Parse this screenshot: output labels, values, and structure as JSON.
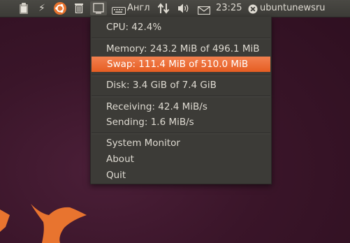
{
  "topbar": {
    "keyboard_layout": "Англ",
    "clock": "23:25",
    "username": "ubuntunewsru",
    "icons": [
      "clipboard-icon",
      "bolt-icon",
      "ubuntu-icon",
      "trash-icon",
      "system-monitor-icon",
      "keyboard-icon",
      "network-arrows-icon",
      "volume-icon",
      "mail-icon",
      "session-icon"
    ]
  },
  "menu": {
    "cpu": "CPU: 42.4%",
    "memory": "Memory: 243.2 MiB of 496.1 MiB",
    "swap": "Swap: 111.4 MiB of 510.0 MiB",
    "disk": "Disk: 3.4 GiB of 7.4 GiB",
    "receiving": "Receiving: 42.4 MiB/s",
    "sending": "Sending: 1.6 MiB/s",
    "system_monitor": "System Monitor",
    "about": "About",
    "quit": "Quit"
  },
  "colors": {
    "panel": "#3c3b37",
    "highlight": "#e9662c",
    "text": "#dfdbd2",
    "desktop": "#3a1529",
    "wallpaper_orange": "#e8742f"
  }
}
